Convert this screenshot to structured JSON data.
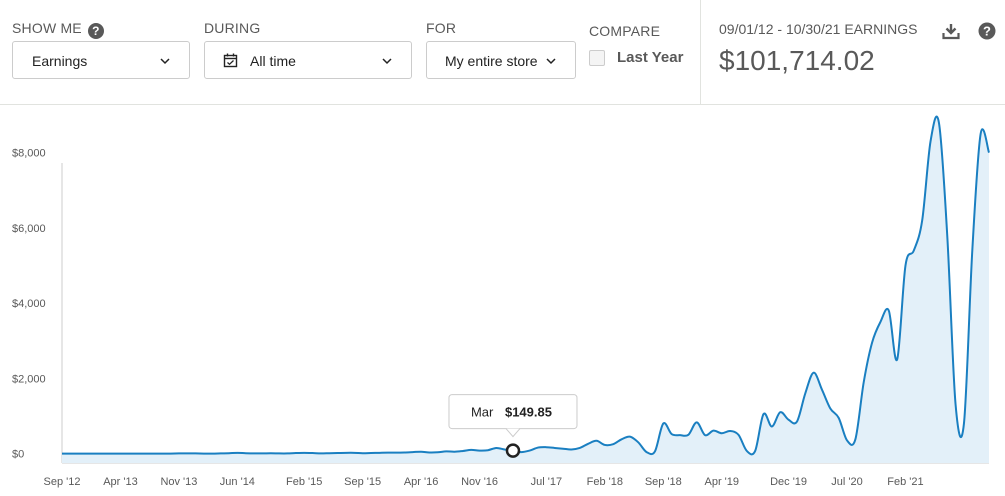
{
  "filters": {
    "show_me": {
      "label": "SHOW ME",
      "value": "Earnings"
    },
    "during": {
      "label": "DURING",
      "value": "All time"
    },
    "for": {
      "label": "FOR",
      "value": "My entire store"
    },
    "compare": {
      "label": "COMPARE",
      "option": "Last Year",
      "checked": false
    }
  },
  "summary": {
    "range_label": "09/01/12 - 10/30/21 EARNINGS",
    "total": "$101,714.02"
  },
  "icons": {
    "help": "question-circle-icon",
    "download": "download-icon",
    "dropdown": "chevron-down-icon",
    "calendar": "calendar-icon"
  },
  "colors": {
    "line": "#1a7fc1",
    "fill": "#e3f0f9",
    "axis": "#cccccc",
    "tick_text": "#595959"
  },
  "chart_data": {
    "type": "area",
    "title": "",
    "xlabel": "",
    "ylabel": "",
    "ylim": [
      -250,
      9000
    ],
    "y_ticks": [
      {
        "label": "$8,000",
        "value": 8000
      },
      {
        "label": "$6,000",
        "value": 6000
      },
      {
        "label": "$4,000",
        "value": 4000
      },
      {
        "label": "$2,000",
        "value": 2000
      },
      {
        "label": "$0",
        "value": 0
      }
    ],
    "x_ticks": [
      {
        "label": "Sep '12",
        "index": 0
      },
      {
        "label": "Apr '13",
        "index": 7
      },
      {
        "label": "Nov '13",
        "index": 14
      },
      {
        "label": "Jun '14",
        "index": 21
      },
      {
        "label": "Feb '15",
        "index": 29
      },
      {
        "label": "Sep '15",
        "index": 36
      },
      {
        "label": "Apr '16",
        "index": 43
      },
      {
        "label": "Nov '16",
        "index": 50
      },
      {
        "label": "Jul '17",
        "index": 58
      },
      {
        "label": "Feb '18",
        "index": 65
      },
      {
        "label": "Sep '18",
        "index": 72
      },
      {
        "label": "Apr '19",
        "index": 79
      },
      {
        "label": "Dec '19",
        "index": 87
      },
      {
        "label": "Jul '20",
        "index": 94
      },
      {
        "label": "Feb '21",
        "index": 101
      }
    ],
    "series": [
      {
        "values": [
          0,
          0,
          0,
          0,
          0,
          0,
          0,
          0,
          0,
          0,
          0,
          0,
          0,
          0,
          5,
          5,
          5,
          0,
          0,
          5,
          10,
          20,
          10,
          5,
          5,
          10,
          5,
          5,
          15,
          20,
          15,
          5,
          10,
          15,
          20,
          20,
          10,
          15,
          20,
          25,
          25,
          30,
          40,
          50,
          30,
          35,
          60,
          50,
          70,
          100,
          80,
          90,
          150,
          110,
          80,
          40,
          80,
          160,
          170,
          150,
          130,
          110,
          150,
          260,
          340,
          230,
          250,
          380,
          450,
          300,
          40,
          60,
          800,
          520,
          490,
          500,
          830,
          490,
          610,
          540,
          600,
          500,
          70,
          70,
          1050,
          720,
          1100,
          900,
          850,
          1600,
          2150,
          1700,
          1200,
          950,
          350,
          380,
          1900,
          2950,
          3500,
          3800,
          2500,
          5000,
          5400,
          6200,
          8300,
          8800,
          5800,
          1300,
          800,
          5400,
          8500,
          8000
        ],
        "tooltip": {
          "index": 54,
          "month": "Mar",
          "value": "$149.85"
        }
      }
    ]
  }
}
